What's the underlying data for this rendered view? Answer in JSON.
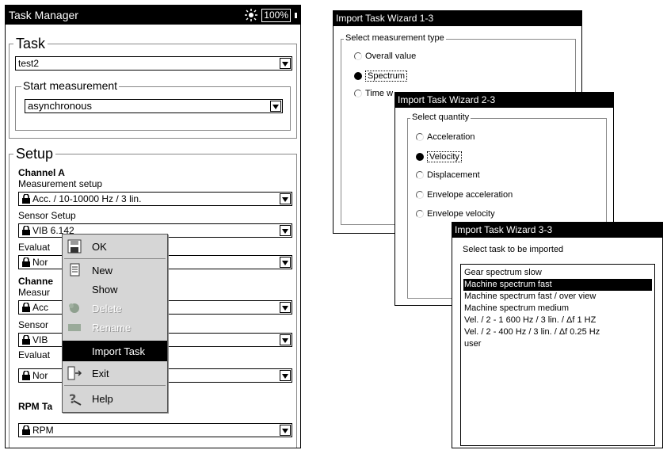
{
  "task_manager": {
    "title": "Task Manager",
    "battery": "100%",
    "task_group": "Task",
    "task_name": "test2",
    "start_group": "Start measurement",
    "start_value": "asynchronous",
    "setup_group": "Setup",
    "channel_a": "Channel A",
    "measurement_setup_label": "Measurement setup",
    "measurement_setup_value": "Acc. / 10-10000 Hz / 3 lin.",
    "sensor_setup_label": "Sensor Setup",
    "sensor_setup_value": "VIB 6.142",
    "evaluation_label": "Evaluat",
    "evaluation_value": "Nor",
    "channel_b": "Channe",
    "measurement_b_label": "Measur",
    "measurement_b_value": "Acc",
    "sensor_b_label": "Sensor",
    "sensor_b_value": "VIB",
    "evaluation_b_label": "Evaluat",
    "evaluation_b_value": "Nor",
    "rpm_label": "RPM Ta",
    "rpm_value": "RPM"
  },
  "context_menu": {
    "items": [
      {
        "label": "OK",
        "icon": "save-icon",
        "enabled": true
      },
      {
        "label": "New",
        "icon": "new-document-icon",
        "enabled": true
      },
      {
        "label": "Show",
        "icon": "",
        "enabled": true
      },
      {
        "label": "Delete",
        "icon": "delete-icon",
        "enabled": false
      },
      {
        "label": "Rename",
        "icon": "rename-icon",
        "enabled": false
      },
      {
        "label": "Import Task",
        "icon": "",
        "enabled": true,
        "selected": true
      },
      {
        "label": "Exit",
        "icon": "exit-icon",
        "enabled": true
      },
      {
        "label": "Help",
        "icon": "help-icon",
        "enabled": true
      }
    ]
  },
  "wizard1": {
    "title": "Import Task Wizard 1-3",
    "group": "Select measurement type",
    "options": [
      "Overall value",
      "Spectrum",
      "Time w"
    ],
    "selected": 1
  },
  "wizard2": {
    "title": "Import Task Wizard 2-3",
    "group": "Select quantity",
    "options": [
      "Acceleration",
      "Velocity",
      "Displacement",
      "Envelope acceleration",
      "Envelope velocity"
    ],
    "selected": 1
  },
  "wizard3": {
    "title": "Import Task Wizard 3-3",
    "prompt": "Select task to be imported",
    "items": [
      "Gear spectrum slow",
      "Machine spectrum fast",
      "Machine spectrum fast / over view",
      "Machine spectrum medium",
      "Vel. / 2 - 1 600 Hz / 3 lin. / Δf 1 HZ",
      "Vel. / 2 - 400 Hz / 3 lin. / Δf 0.25 Hz",
      "user"
    ],
    "selected": 1
  }
}
